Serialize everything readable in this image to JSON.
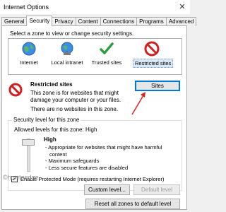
{
  "window": {
    "title": "Internet Options",
    "close_icon": "close-icon"
  },
  "tabs": [
    "General",
    "Security",
    "Privacy",
    "Content",
    "Connections",
    "Programs",
    "Advanced"
  ],
  "prompt": "Select a zone to view or change security settings.",
  "zones": [
    {
      "label": "Internet",
      "icon": "globe-icon"
    },
    {
      "label": "Local intranet",
      "icon": "intranet-globe-icon"
    },
    {
      "label": "Trusted sites",
      "icon": "checkmark-icon"
    },
    {
      "label": "Restricted sites",
      "icon": "no-entry-icon",
      "selected": true
    }
  ],
  "zone_info": {
    "title": "Restricted sites",
    "description": "This zone is for websites that might damage your computer or your files.",
    "no_websites": "There are no websites in this zone."
  },
  "buttons": {
    "sites": "Sites",
    "custom_level": "Custom level...",
    "default_level": "Default level",
    "reset_all": "Reset all zones to default level"
  },
  "security_level": {
    "legend": "Security level for this zone",
    "allowed": "Allowed levels for this zone: High",
    "level": "High",
    "bullets": [
      "- Appropriate for websites that might have harmful",
      "  content",
      "- Maximum safeguards",
      "- Less secure features are disabled"
    ]
  },
  "protected_mode": {
    "label": "Enable Protected Mode (requires restarting Internet Explorer)",
    "checked": true
  },
  "watermark": "©howtoedge",
  "colors": {
    "accent": "#0078d7",
    "arrow": "#e02020",
    "no_entry": "#d21f1f"
  }
}
